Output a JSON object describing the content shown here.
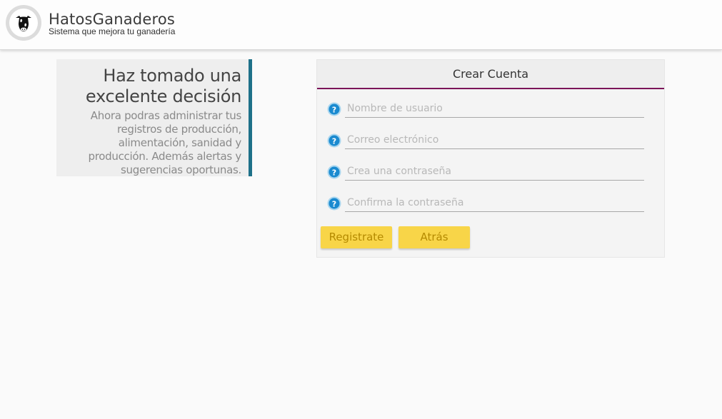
{
  "header": {
    "title": "HatosGanaderos",
    "subtitle": "Sistema que mejora tu ganadería",
    "logo_icon": "cow-icon"
  },
  "info": {
    "heading": "Haz tomado una excelente decisión",
    "body": "Ahora podras administrar tus registros de producción, alimentación, sanidad y producción. Además alertas y sugerencias oportunas.",
    "accent_color": "#1e7189"
  },
  "form": {
    "title": "Crear Cuenta",
    "accent_color": "#7b1459",
    "fields": [
      {
        "placeholder": "Nombre de usuario",
        "value": "",
        "icon": "help-icon"
      },
      {
        "placeholder": "Correo electrónico",
        "value": "",
        "icon": "help-icon"
      },
      {
        "placeholder": "Crea una contraseña",
        "value": "",
        "icon": "help-icon"
      },
      {
        "placeholder": "Confirma la contraseña",
        "value": "",
        "icon": "help-icon"
      }
    ],
    "register_label": "Registrate",
    "back_label": "Atrás",
    "button_color": "#f8d548"
  }
}
